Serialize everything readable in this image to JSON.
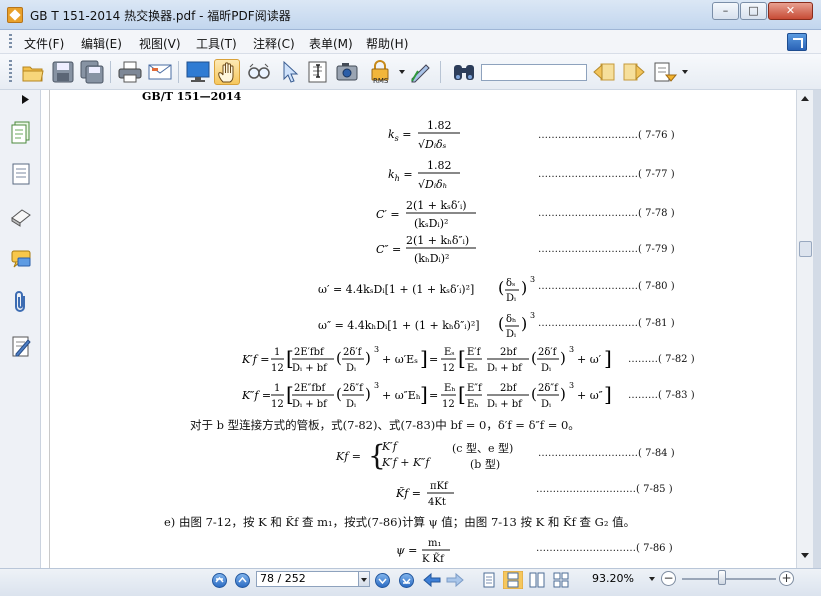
{
  "window": {
    "title": "GB T 151-2014  热交换器.pdf - 福昕PDF阅读器",
    "min": "–",
    "max": "□",
    "close": "✕"
  },
  "menu": [
    {
      "label": "文件(F)"
    },
    {
      "label": "编辑(E)"
    },
    {
      "label": "视图(V)"
    },
    {
      "label": "工具(T)"
    },
    {
      "label": "注释(C)"
    },
    {
      "label": "表单(M)"
    },
    {
      "label": "帮助(H)"
    }
  ],
  "toolbar": {
    "icons": [
      "open-icon",
      "save-icon",
      "save-as-icon",
      "print-icon",
      "email-icon",
      "fullscreen-icon",
      "hand-tool-icon",
      "zoom-glass-icon",
      "select-arrow-icon",
      "text-select-icon",
      "snapshot-icon",
      "rms-lock-icon",
      "sign-icon",
      "binoculars-search-icon",
      "prev-result-icon",
      "next-result-icon",
      "highlight-icon"
    ],
    "active": "hand-tool-icon",
    "rms_label": "RMS",
    "search_value": ""
  },
  "sidebar": {
    "icons": [
      "pages-icon",
      "bookmarks-icon",
      "layers-icon",
      "comments-icon",
      "attachments-icon",
      "signatures-icon"
    ]
  },
  "document": {
    "header": "GB/T  151—2014",
    "equations": [
      {
        "lhs": "kₛ = 1.82 / √(Dᵢ δₛ)",
        "num": "(7-76)"
      },
      {
        "lhs": "kₕ = 1.82 / √(Dᵢ δₕ)",
        "num": "(7-77)"
      },
      {
        "lhs": "C′ = 2(1 + kₛδ′ᵢ) / (kₛDᵢ)²",
        "num": "(7-78)"
      },
      {
        "lhs": "C″ = 2(1 + kₕδ″ᵢ) / (kₕDᵢ)²",
        "num": "(7-79)"
      },
      {
        "lhs": "ω′ = 4.4kₛDᵢ[1 + (1 + kₛδ′ᵢ)²](δₛ/Dᵢ)³",
        "num": "(7-80)"
      },
      {
        "lhs": "ω″ = 4.4kₕDᵢ[1 + (1 + kₕδ″ᵢ)²](δₕ/Dᵢ)³",
        "num": "(7-81)"
      },
      {
        "lhs": "K′f = 1/12 [ 2E′fbf/(Dᵢ+bf) (2δ′f/Dᵢ)³ + ω′Eₛ ] = Eₛ/12 [ E′f/Eₛ · 2bf/(Dᵢ+bf) (2δ′f/Dᵢ)³ + ω′ ]",
        "num": "(7-82)"
      },
      {
        "lhs": "K″f = 1/12 [ 2E″fbf/(Dᵢ+bf) (2δ″f/Dᵢ)³ + ω″Eₕ ] = Eₕ/12 [ E″f/Eₕ · 2bf/(Dᵢ+bf) (2δ″f/Dᵢ)³ + ω″ ]",
        "num": "(7-83)"
      }
    ],
    "text_b": "对于 b 型连接方式的管板，式(7-82)、式(7-83)中 bf = 0，δ′f = δ″f = 0。",
    "eq84": {
      "lhs": "Kf =",
      "case1": "K′f",
      "case1_note": "(c 型、e 型)",
      "case2": "K′f + K″f",
      "case2_note": "(b 型)",
      "num": "(7-84)"
    },
    "eq85": {
      "lhs": "K̃f = πKf / 4Kt",
      "num": "(7-85)"
    },
    "text_e": "e)   由图 7-12，按 K 和 K̃f 查 m₁，按式(7-86)计算 ψ 值；由图 7-13 按 K 和 K̃f 查 G₂ 值。",
    "eq86": {
      "lhs": "ψ = m₁ / (K K̃f)",
      "num": "(7-86)"
    }
  },
  "status": {
    "page_value": "78 / 252",
    "zoom": "93.20%",
    "zoom_out": "−",
    "zoom_in": "+"
  }
}
